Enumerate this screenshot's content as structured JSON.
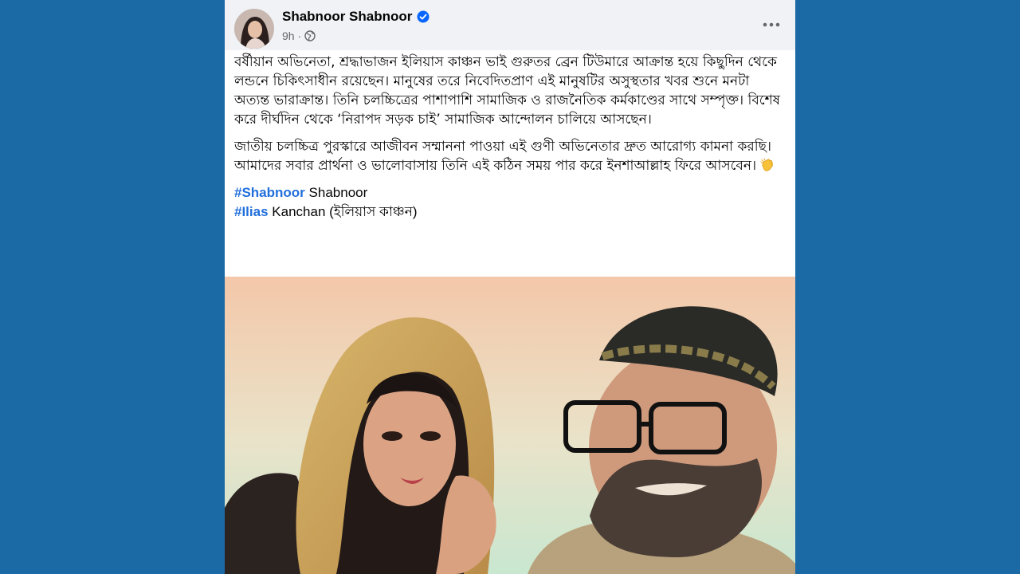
{
  "post": {
    "author": "Shabnoor Shabnoor",
    "time": "9h",
    "meta_separator": "·",
    "visibility_icon": "globe-icon",
    "verified_icon": "verified-badge-icon",
    "more_icon": "more-options-icon",
    "paragraph1": "বর্ষীয়ান অভিনেতা, শ্রদ্ধাভাজন ইলিয়াস কাঞ্চন ভাই গুরুতর ব্রেন টিউমারে আক্রান্ত হয়ে কিছুদিন থেকে লন্ডনে চিকিৎসাধীন রয়েছেন। মানুষের তরে নিবেদিতপ্রাণ এই মানুষটির অসুস্থতার খবর শুনে মনটা অত্যন্ত ভারাক্রান্ত। তিনি চলচ্চিত্রের পাশাপাশি সামাজিক ও রাজনৈতিক কর্মকাণ্ডের সাথে সম্পৃক্ত। বিশেষ করে দীর্ঘদিন থেকে ‘নিরাপদ সড়ক চাই’ সামাজিক আন্দোলন চালিয়ে আসছেন।",
    "paragraph2": "জাতীয় চলচ্চিত্র পুরস্কারে আজীবন সম্মাননা পাওয়া এই গুণী অভিনেতার দ্রুত আরোগ্য কামনা করছি। আমাদের সবার প্রার্থনা ও ভালোবাসায় তিনি এই কঠিন সময় পার করে ইনশাআল্লাহ ফিরে আসবেন।",
    "paragraph2_emoji": "clapping-hands-icon",
    "tags": [
      {
        "hashtag": "#Shabnoor",
        "text": "Shabnoor"
      },
      {
        "hashtag": "#Ilias",
        "text": "Kanchan (ইলিয়াস কাঞ্চন)"
      }
    ]
  },
  "colors": {
    "page_background": "#1b6aa6",
    "header_background": "#f0f2f5",
    "hashtag": "#216fdb",
    "verified": "#0866ff",
    "meta_text": "#65676b"
  }
}
